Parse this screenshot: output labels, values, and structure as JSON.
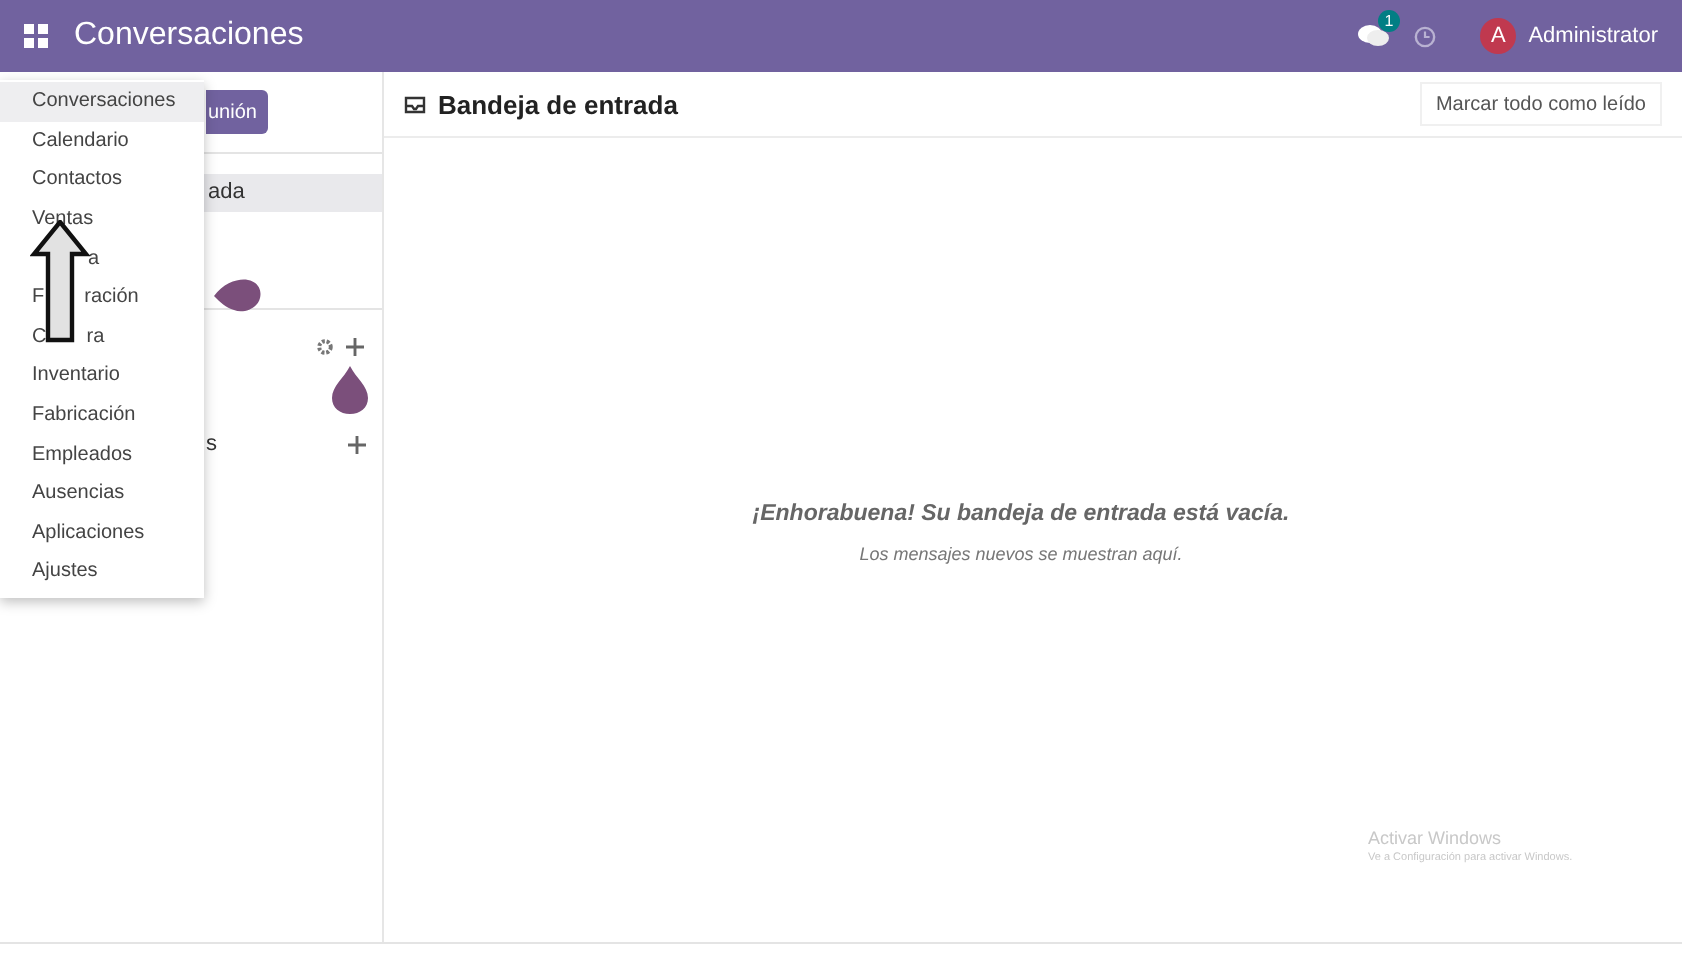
{
  "topbar": {
    "title": "Conversaciones",
    "chat_badge": "1",
    "user_initial": "A",
    "user_name": "Administrator"
  },
  "sidebar": {
    "button": "unión",
    "items": [
      {
        "label": "ada",
        "selected": true
      }
    ],
    "section_label": "s"
  },
  "app_menu": [
    {
      "kind": "whole",
      "label": "Conversaciones",
      "selected": true
    },
    {
      "kind": "whole",
      "label": "Calendario",
      "selected": false
    },
    {
      "kind": "whole",
      "label": "Contactos",
      "selected": false
    },
    {
      "kind": "whole",
      "label": "Ventas",
      "selected": false
    },
    {
      "kind": "tail",
      "right": "a",
      "selected": false
    },
    {
      "kind": "split",
      "left": "F",
      "right": "ración",
      "selected": false
    },
    {
      "kind": "split",
      "left": "C",
      "right": "ra",
      "selected": false
    },
    {
      "kind": "whole",
      "label": "Inventario",
      "selected": false
    },
    {
      "kind": "whole",
      "label": "Fabricación",
      "selected": false
    },
    {
      "kind": "whole",
      "label": "Empleados",
      "selected": false
    },
    {
      "kind": "whole",
      "label": "Ausencias",
      "selected": false
    },
    {
      "kind": "whole",
      "label": "Aplicaciones",
      "selected": false
    },
    {
      "kind": "whole",
      "label": "Ajustes",
      "selected": false
    }
  ],
  "main": {
    "title": "Bandeja de entrada",
    "mark_all_button": "Marcar todo como leído",
    "empty_title": "¡Enhorabuena! Su bandeja de entrada está vacía.",
    "empty_text": "Los mensajes nuevos se muestran aquí."
  },
  "os_notice": {
    "title": "Activar Windows",
    "text": "Ve a Configuración para activar Windows."
  }
}
